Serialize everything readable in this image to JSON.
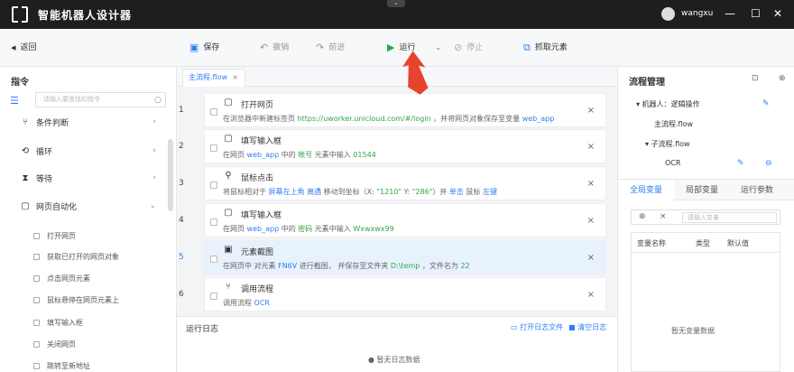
{
  "app": {
    "title": "智能机器人设计器",
    "user": "wangxu"
  },
  "toolbar": {
    "back": "返回",
    "save": "保存",
    "undo": "撤销",
    "redo": "前进",
    "run": "运行",
    "stop": "停止",
    "capture": "抓取元素"
  },
  "left": {
    "title": "指令",
    "search_placeholder": "请输入要查找的指令",
    "categories": [
      "条件判断",
      "循环",
      "等待",
      "网页自动化"
    ],
    "subitems": [
      "打开网页",
      "获取已打开的网页对象",
      "点击网页元素",
      "鼠标悬停在网页元素上",
      "填写输入框",
      "关闭网页",
      "跳转至新地址"
    ]
  },
  "editor": {
    "tab": "主流程.flow",
    "steps": [
      {
        "num": "1",
        "title": "打开网页",
        "desc": [
          "在浏览器中新建标签页 ",
          "https://uworker.unicloud.com/#/login",
          " ，并将网页对象保存至变量 ",
          "web_app"
        ]
      },
      {
        "num": "2",
        "title": "填写输入框",
        "desc": [
          "在网页 ",
          "web_app",
          " 中的 ",
          "帐号",
          " 元素中输入 ",
          "01544"
        ]
      },
      {
        "num": "3",
        "title": "鼠标点击",
        "desc": [
          "将鼠标相对于 ",
          "屏幕左上角",
          " ",
          "离遇",
          " 移动到坐标（X: ",
          "\"1210\"",
          " Y: ",
          "\"286\"",
          "）并 ",
          "单击",
          " 鼠标 ",
          "左键"
        ]
      },
      {
        "num": "4",
        "title": "填写输入框",
        "desc": [
          "在网页 ",
          "web_app",
          " 中的 ",
          "密码",
          " 元素中输入 ",
          "Wxwxwx99"
        ]
      },
      {
        "num": "5",
        "title": "元素截图",
        "desc": [
          "在网页中 对元素 ",
          "FN6V",
          " 进行截图， 并保存至文件夹 ",
          "D:\\temp",
          " ，文件名为 ",
          "22"
        ]
      },
      {
        "num": "6",
        "title": "调用流程",
        "desc": [
          "调用流程 ",
          "OCR"
        ]
      }
    ]
  },
  "log": {
    "title": "运行日志",
    "open_file": "打开日志文件",
    "clear": "清空日志",
    "empty": "暂无日志数据"
  },
  "right": {
    "title": "流程管理",
    "robot": "机器人：逻辑操作",
    "main_flow": "主流程.flow",
    "sub_flow": "子流程.flow",
    "ocr": "OCR",
    "tabs": [
      "全局变量",
      "局部变量",
      "运行参数"
    ],
    "var_placeholder": "请输入变量",
    "columns": [
      "变量名称",
      "类型",
      "默认值"
    ],
    "empty": "暂无变量数据"
  },
  "colors": {
    "accent": "#2f7ef6",
    "green": "#31a64b",
    "arrow": "#e8432e"
  }
}
